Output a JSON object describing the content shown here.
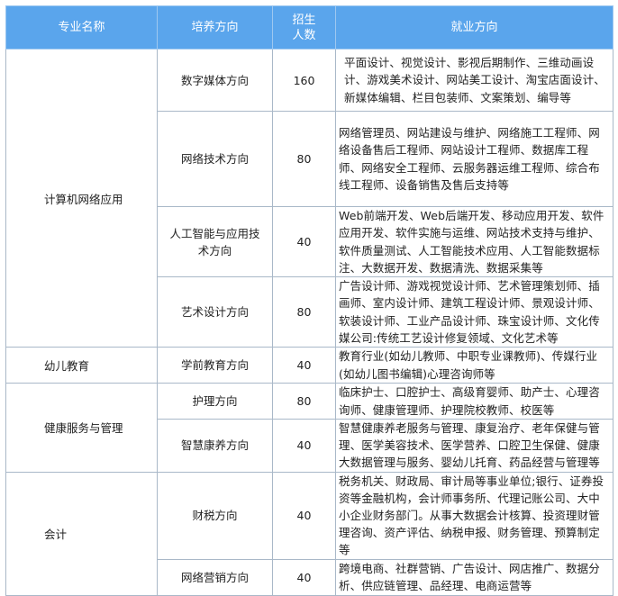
{
  "headers": {
    "major": "专业名称",
    "direction": "培养方向",
    "enroll_line1": "招生",
    "enroll_line2": "人数",
    "employment": "就业方向"
  },
  "groups": [
    {
      "major": "计算机网络应用",
      "rows": [
        {
          "direction": "数字媒体方向",
          "count": "160",
          "jobs": "平面设计、视觉设计、影视后期制作、三维动画设计、游戏美术设计、网站美工设计、淘宝店面设计、新媒体编辑、栏目包装师、文案策划、编导等"
        },
        {
          "direction": "网络技术方向",
          "count": "80",
          "jobs": "网络管理员、网站建设与维护、网络施工工程师、网络设备售后工程师、网站设计工程师、数据库工程师、网络安全工程师、云服务器运维工程师、综合布线工程师、设备销售及售后支持等"
        },
        {
          "direction": "人工智能与应用技术方向",
          "count": "40",
          "jobs": "Web前端开发、Web后端开发、移动应用开发、软件应用开发、软件实施与运维、网站技术支持与维护、软件质量测试、人工智能技术应用、人工智能数据标注、大数据开发、数据清洗、数据采集等"
        },
        {
          "direction": "艺术设计方向",
          "count": "80",
          "jobs": "广告设计师、游戏视觉设计师、艺术管理策划师、插画师、室内设计师、建筑工程设计师、景观设计师、软装设计师、工业产品设计师、珠宝设计师、文化传媒公司:传统工艺设计修复领域、文化艺术等"
        }
      ]
    },
    {
      "major": "幼儿教育",
      "rows": [
        {
          "direction": "学前教育方向",
          "count": "40",
          "jobs": "教育行业(如幼儿教师、中职专业课教师)、传媒行业(如幼儿图书编辑)心理咨询师等"
        }
      ]
    },
    {
      "major": "健康服务与管理",
      "rows": [
        {
          "direction": "护理方向",
          "count": "80",
          "jobs": "临床护士、口腔护士、高级育婴师、助产士、心理咨询师、健康管理师、护理院校教师、校医等"
        },
        {
          "direction": "智慧康养方向",
          "count": "40",
          "jobs": "智慧健康养老服务与管理、康复治疗、老年保健与管理、医学美容技术、医学营养、口腔卫生保健、健康大数据管理与服务、婴幼儿托育、药品经营与管理等"
        }
      ]
    },
    {
      "major": "会计",
      "rows": [
        {
          "direction": "财税方向",
          "count": "40",
          "jobs": "税务机关、财政局、审计局等事业单位;银行、证券投资等金融机构，会计师事务所、代理记账公司、大中小企业财务部门。从事大数据会计核算、投资理财管理咨询、资产评估、纳税申报、财务管理、预算制定等"
        },
        {
          "direction": "网络营销方向",
          "count": "40",
          "jobs": "跨境电商、社群营销、广告设计、网店推广、数据分析、供应链管理、品经理、电商运营等"
        }
      ]
    }
  ]
}
